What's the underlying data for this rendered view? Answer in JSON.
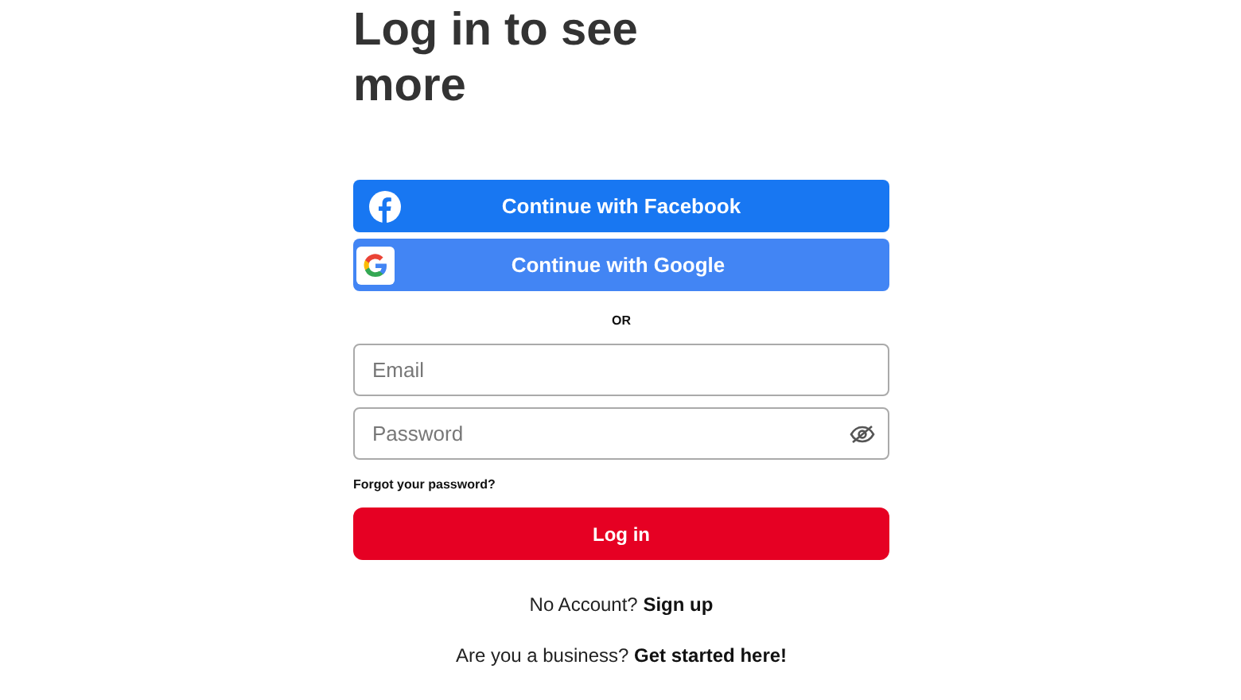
{
  "heading": "Log in to see more",
  "social_buttons": [
    {
      "kind": "facebook",
      "label": "Continue with Facebook"
    },
    {
      "kind": "google",
      "label": "Continue with Google"
    }
  ],
  "divider": "OR",
  "fields": [
    {
      "placeholder": "Email",
      "kind": "text"
    },
    {
      "placeholder": "Password",
      "kind": "password"
    }
  ],
  "forgot_link": "Forgot your password?",
  "login_button": "Log in",
  "signup": {
    "text": "No Account?",
    "link": "Sign up"
  },
  "business": {
    "text": "Are you a business?",
    "link": "Get started here!"
  }
}
